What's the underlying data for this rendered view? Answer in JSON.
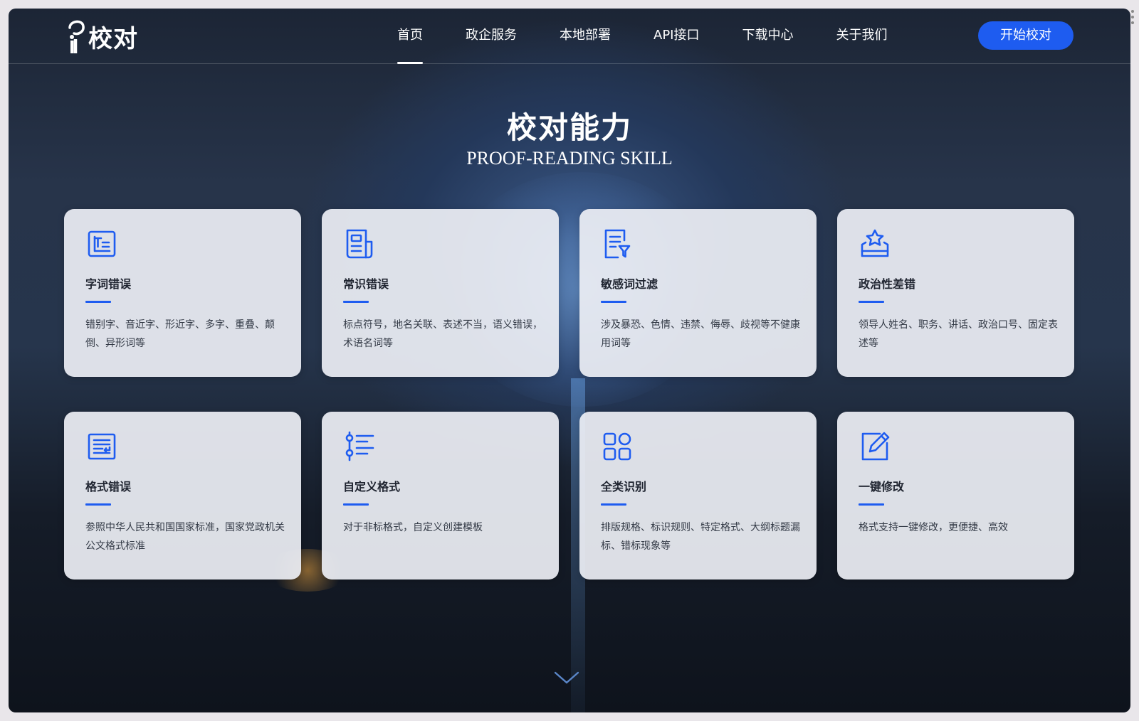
{
  "brand": {
    "logo_text": "校对"
  },
  "nav": {
    "items": [
      {
        "label": "首页",
        "active": true
      },
      {
        "label": "政企服务",
        "active": false
      },
      {
        "label": "本地部署",
        "active": false
      },
      {
        "label": "API接口",
        "active": false
      },
      {
        "label": "下载中心",
        "active": false
      },
      {
        "label": "关于我们",
        "active": false
      }
    ],
    "cta_label": "开始校对"
  },
  "section": {
    "title": "校对能力",
    "subtitle": "PROOF-READING SKILL"
  },
  "cards": [
    {
      "icon": "text-frame-icon",
      "title": "字词错误",
      "desc": "错别字、音近字、形近字、多字、重叠、颠倒、异形词等"
    },
    {
      "icon": "document-icon",
      "title": "常识错误",
      "desc": "标点符号，地名关联、表述不当，语义错误，术语名词等"
    },
    {
      "icon": "filter-list-icon",
      "title": "敏感词过滤",
      "desc": "涉及暴恐、色情、违禁、侮辱、歧视等不健康用词等"
    },
    {
      "icon": "star-badge-icon",
      "title": "政治性差错",
      "desc": "领导人姓名、职务、讲话、政治口号、固定表述等"
    },
    {
      "icon": "format-icon",
      "title": "格式错误",
      "desc": "参照中华人民共和国国家标准，国家党政机关公文格式标准"
    },
    {
      "icon": "custom-list-icon",
      "title": "自定义格式",
      "desc": "对于非标格式，自定义创建模板"
    },
    {
      "icon": "grid-icon",
      "title": "全类识别",
      "desc": "排版规格、标识规则、特定格式、大纲标题漏标、错标现象等"
    },
    {
      "icon": "edit-icon",
      "title": "一键修改",
      "desc": "格式支持一键修改，更便捷、高效"
    }
  ],
  "colors": {
    "accent": "#1e5cf0",
    "card_bg": "#eceef4"
  }
}
